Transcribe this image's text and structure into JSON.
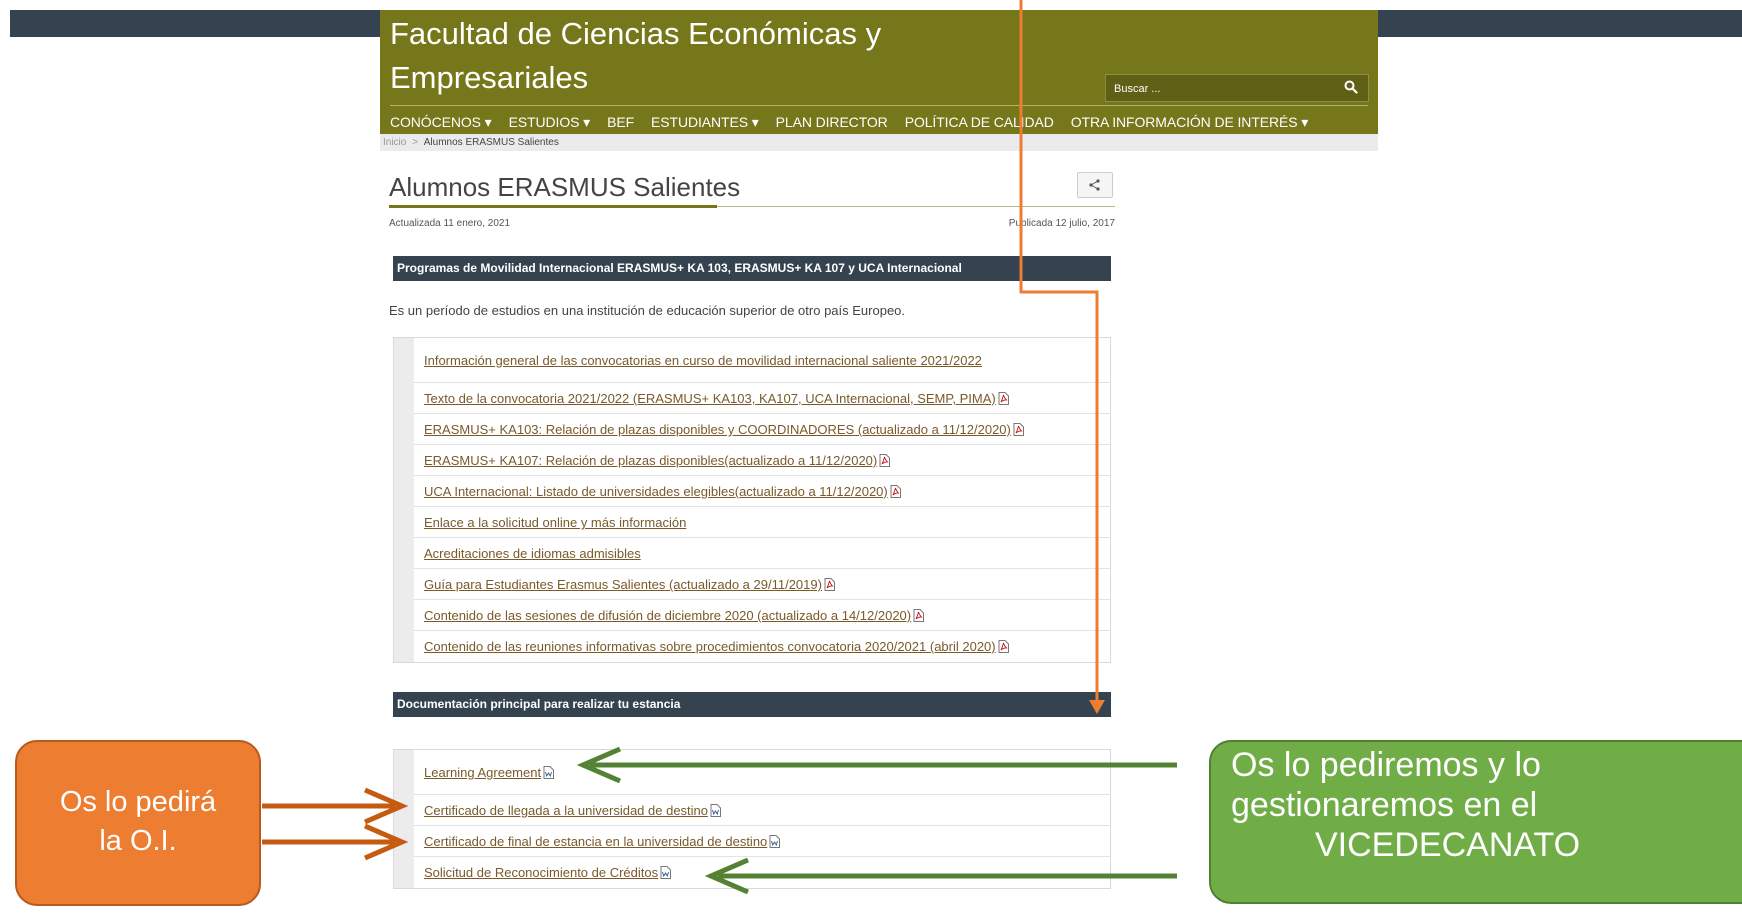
{
  "header": {
    "title": "Facultad de Ciencias Económicas y Empresariales",
    "search_placeholder": "Buscar ...",
    "search_icon": "search-icon",
    "nav": [
      {
        "label": "CONÓCENOS ▾"
      },
      {
        "label": "ESTUDIOS ▾"
      },
      {
        "label": "BEF"
      },
      {
        "label": "ESTUDIANTES ▾"
      },
      {
        "label": "PLAN DIRECTOR"
      },
      {
        "label": "POLÍTICA DE CALIDAD"
      },
      {
        "label": "OTRA INFORMACIÓN DE INTERÉS ▾"
      }
    ]
  },
  "breadcrumb": {
    "home": "Inicio",
    "separator": ">",
    "current": "Alumnos ERASMUS Salientes"
  },
  "page": {
    "title": "Alumnos ERASMUS Salientes",
    "updated": "Actualizada 11 enero, 2021",
    "published": "Publicada 12 julio, 2017",
    "share_icon": "share-icon"
  },
  "section1": {
    "heading": "Programas de Movilidad Internacional ERASMUS+ KA 103, ERASMUS+ KA 107 y UCA Internacional",
    "intro": "Es un período de estudios en una institución de educación superior de otro país Europeo.",
    "links": [
      {
        "label": "Información general de las convocatorias en curso de movilidad internacional saliente 2021/2022",
        "icon": ""
      },
      {
        "label": "Texto de la convocatoria 2021/2022 (ERASMUS+ KA103, KA107, UCA Internacional, SEMP, PIMA)",
        "icon": "pdf-icon"
      },
      {
        "label": "ERASMUS+ KA103: Relación de plazas disponibles y COORDINADORES (actualizado a 11/12/2020)",
        "icon": "pdf-icon"
      },
      {
        "label": "ERASMUS+ KA107: Relación de plazas disponibles(actualizado a 11/12/2020)",
        "icon": "pdf-icon"
      },
      {
        "label": "UCA Internacional: Listado de universidades elegibles(actualizado a 11/12/2020)",
        "icon": "pdf-icon"
      },
      {
        "label": "Enlace a la solicitud online y más información",
        "icon": ""
      },
      {
        "label": "Acreditaciones de idiomas admisibles",
        "icon": ""
      },
      {
        "label": "Guía para Estudiantes Erasmus Salientes (actualizado a 29/11/2019)",
        "icon": "pdf-icon"
      },
      {
        "label": "Contenido de las sesiones de difusión de diciembre 2020 (actualizado a 14/12/2020)",
        "icon": "pdf-icon"
      },
      {
        "label": "Contenido de las reuniones informativas sobre procedimientos convocatoria 2020/2021 (abril 2020)",
        "icon": "pdf-icon"
      }
    ]
  },
  "section2": {
    "heading": "Documentación principal para realizar tu estancia",
    "links": [
      {
        "label": "Learning Agreement",
        "icon": "doc-icon"
      },
      {
        "label": "Certificado de llegada a la universidad de destino",
        "icon": "doc-icon"
      },
      {
        "label": "Certificado de final de estancia en la universidad de destino",
        "icon": "doc-icon"
      },
      {
        "label": "Solicitud de Reconocimiento de Créditos",
        "icon": "doc-icon"
      }
    ]
  },
  "annotations": {
    "orange_callout": "Os lo pedirá la O.I.",
    "orange_callout_lines": [
      "Os lo pedirá",
      "la O.I."
    ],
    "green_callout": "Os lo pediremos y lo gestionaremos en el VICEDECANATO",
    "green_callout_lines": [
      "Os lo pediremos y lo",
      "gestionaremos en el",
      "VICEDECANATO"
    ],
    "colors": {
      "orange": "#ed7d31",
      "dark_orange": "#c55a11",
      "green": "#70ad47",
      "dark_green": "#548235"
    }
  }
}
